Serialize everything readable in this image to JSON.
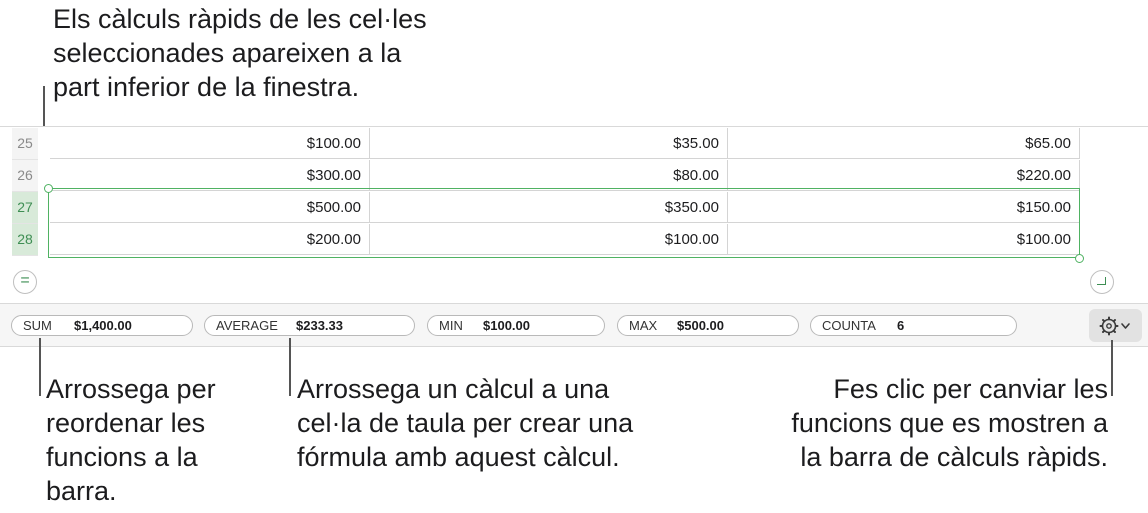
{
  "callouts": {
    "top": "Els càlculs ràpids de les cel·les\nseleccionades apareixen a la\npart inferior de la finestra.",
    "drag_reorder": "Arrossega per\nreordenar les\nfuncions a la\nbarra.",
    "drag_to_cell": "Arrossega un càlcul a una\ncel·la de taula per crear una\nfórmula amb aquest càlcul.",
    "change_functions": "Fes clic per canviar les\nfuncions que es mostren a\nla barra de càlculs ràpids."
  },
  "table": {
    "rows": [
      {
        "num": "25",
        "cells": [
          "$100.00",
          "$35.00",
          "$65.00"
        ],
        "selected": false
      },
      {
        "num": "26",
        "cells": [
          "$300.00",
          "$80.00",
          "$220.00"
        ],
        "selected": false
      },
      {
        "num": "27",
        "cells": [
          "$500.00",
          "$350.00",
          "$150.00"
        ],
        "selected": true
      },
      {
        "num": "28",
        "cells": [
          "$200.00",
          "$100.00",
          "$100.00"
        ],
        "selected": true
      }
    ]
  },
  "quick_calc": {
    "items": [
      {
        "name": "SUM",
        "value": "$1,400.00"
      },
      {
        "name": "AVERAGE",
        "value": "$233.33"
      },
      {
        "name": "MIN",
        "value": "$100.00"
      },
      {
        "name": "MAX",
        "value": "$500.00"
      },
      {
        "name": "COUNTA",
        "value": "6"
      }
    ],
    "settings_icon": "gear-icon"
  },
  "colors": {
    "selection": "#4fb262",
    "selected_row_header": "#d8ead9"
  }
}
